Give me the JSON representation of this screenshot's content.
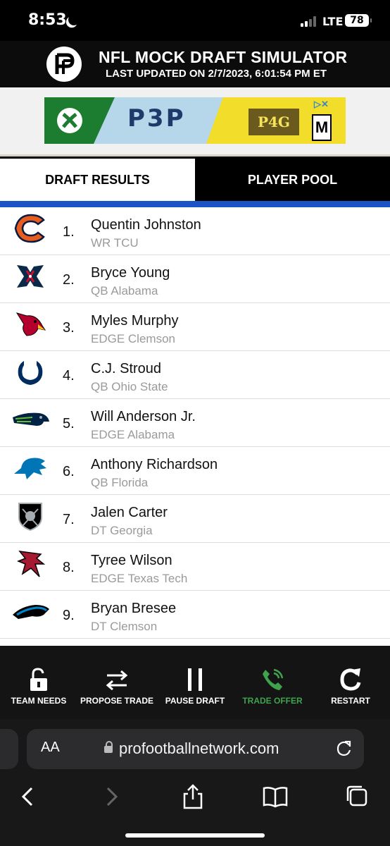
{
  "status_bar": {
    "time": "8:53",
    "network": "LTE",
    "battery": "78"
  },
  "header": {
    "title": "NFL MOCK DRAFT SIMULATOR",
    "subtitle": "LAST UPDATED ON 2/7/2023, 6:01:54 PM ET"
  },
  "ad": {
    "left_game": "P3P",
    "right_game": "P4G",
    "rating": "M"
  },
  "tabs": {
    "results_label": "DRAFT RESULTS",
    "pool_label": "PLAYER POOL"
  },
  "picks": [
    {
      "number": "1.",
      "name": "Quentin Johnston",
      "info": "WR TCU",
      "team_icon": "bears-logo-icon"
    },
    {
      "number": "2.",
      "name": "Bryce Young",
      "info": "QB Alabama",
      "team_icon": "texans-logo-icon"
    },
    {
      "number": "3.",
      "name": "Myles Murphy",
      "info": "EDGE Clemson",
      "team_icon": "cardinals-logo-icon"
    },
    {
      "number": "4.",
      "name": "C.J. Stroud",
      "info": "QB Ohio State",
      "team_icon": "colts-logo-icon"
    },
    {
      "number": "5.",
      "name": "Will Anderson Jr.",
      "info": "EDGE Alabama",
      "team_icon": "seahawks-logo-icon"
    },
    {
      "number": "6.",
      "name": "Anthony Richardson",
      "info": "QB Florida",
      "team_icon": "lions-logo-icon"
    },
    {
      "number": "7.",
      "name": "Jalen Carter",
      "info": "DT Georgia",
      "team_icon": "raiders-logo-icon"
    },
    {
      "number": "8.",
      "name": "Tyree Wilson",
      "info": "EDGE Texas Tech",
      "team_icon": "falcons-logo-icon"
    },
    {
      "number": "9.",
      "name": "Bryan Bresee",
      "info": "DT Clemson",
      "team_icon": "panthers-logo-icon"
    }
  ],
  "actions": {
    "team_needs": "TEAM NEEDS",
    "propose_trade": "PROPOSE TRADE",
    "pause_draft": "PAUSE DRAFT",
    "trade_offer": "TRADE OFFER",
    "restart": "RESTART"
  },
  "browser": {
    "text_size_label": "AA",
    "url": "profootballnetwork.com"
  },
  "colors": {
    "accent_blue": "#1b54c4",
    "trade_offer_green": "#3fa34d"
  }
}
